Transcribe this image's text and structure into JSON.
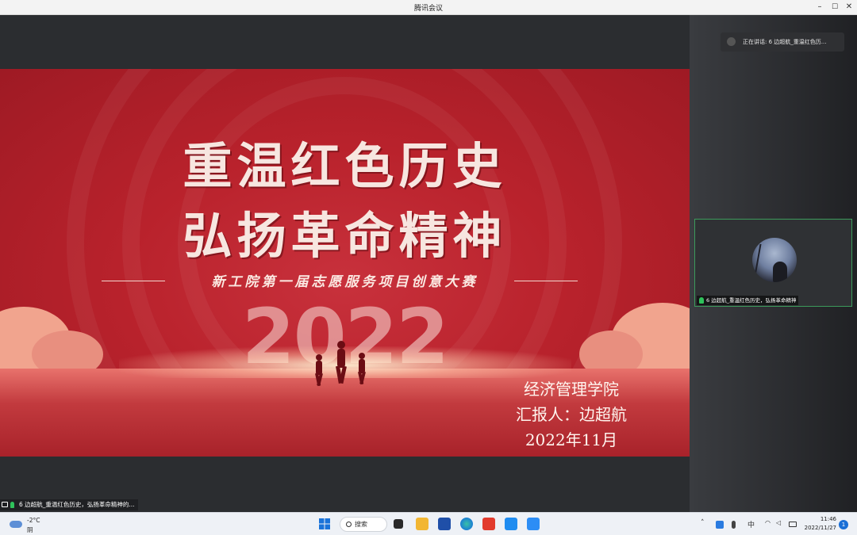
{
  "window": {
    "title": "腾讯会议",
    "minimize": "–",
    "maximize": "☐",
    "close": "✕"
  },
  "slide": {
    "title_line1": "重温红色历史",
    "title_line2": "弘扬革命精神",
    "subtitle": "新工院第一届志愿服务项目创意大赛",
    "year": "2022",
    "college": "经济管理学院",
    "reporter": "汇报人：边超航",
    "date": "2022年11月"
  },
  "panel": {
    "speaking_text": "正在讲话: 6 边超航_重温红色历...",
    "participant_label": "6 边超航_重温红色历史，弘扬革命精神"
  },
  "share_label": "6 边超航_重温红色历史，弘扬革命精神的...",
  "taskbar": {
    "weather_temp": "-2°C",
    "weather_cond": "阴",
    "search_label": "搜索",
    "ime": "中",
    "time": "11:46",
    "date": "2022/11/27",
    "notification_count": "1"
  },
  "colors": {
    "slide_red": "#b9222c",
    "speaker_border": "#3c9b5b",
    "mic_green": "#2fc25b",
    "accent_blue": "#1a6fd6"
  }
}
